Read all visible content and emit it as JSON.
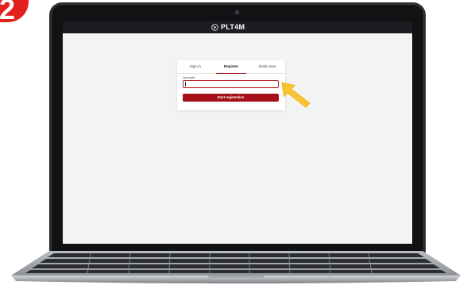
{
  "step": {
    "number": "2"
  },
  "app": {
    "brand_name": "PLT4M"
  },
  "auth_card": {
    "tabs": [
      {
        "label": "Sign in"
      },
      {
        "label": "Register"
      },
      {
        "label": "Kiosk view"
      }
    ],
    "active_tab": "Register",
    "join_code_label": "Join code",
    "join_code_value": "",
    "join_code_placeholder": "",
    "start_button_label": "Start registration"
  },
  "colors": {
    "accent": "#b0121b",
    "button": "#a50f17",
    "header": "#1c1d21",
    "badge": "#e2211c",
    "arrow": "#f7c531"
  },
  "icons": {
    "brand": "play-circle-icon",
    "pointer": "arrow-pointer-icon"
  }
}
